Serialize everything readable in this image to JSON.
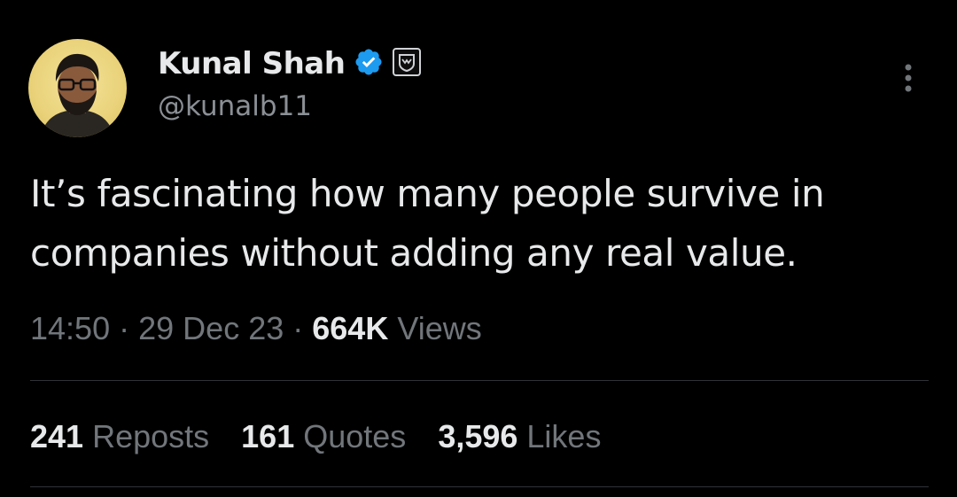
{
  "tweet": {
    "author": {
      "display_name": "Kunal Shah",
      "handle": "@kunalb11",
      "verified_icon": "verified-badge-icon",
      "affiliate_icon": "affiliate-badge-icon",
      "verified_color": "#1d9bf0"
    },
    "text_line_1": "It’s fascinating how many people survive in",
    "text_line_2": "companies without adding any real value.",
    "time": "14:50",
    "sep": "·",
    "date": "29 Dec 23",
    "views_count": "664K",
    "views_label": "Views"
  },
  "stats": {
    "reposts_count": "241",
    "reposts_label": "Reposts",
    "quotes_count": "161",
    "quotes_label": "Quotes",
    "likes_count": "3,596",
    "likes_label": "Likes"
  },
  "icons": {
    "more": "more-vertical-icon"
  },
  "colors": {
    "background": "#000000",
    "primary_text": "#e7e9ea",
    "secondary_text": "#71767b",
    "divider": "#2f3336"
  }
}
